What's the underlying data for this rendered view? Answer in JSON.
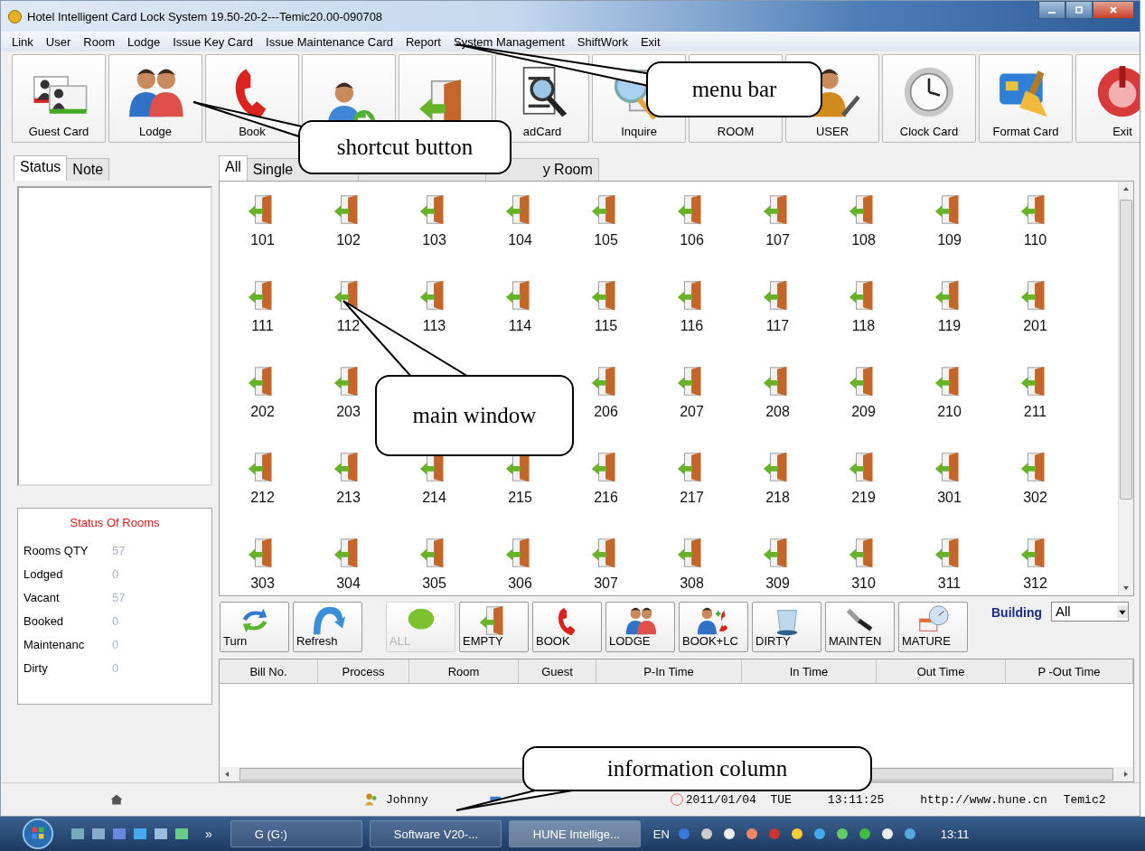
{
  "window": {
    "title": "Hotel Intelligent Card Lock System 19.50-20-2---Temic20.00-090708"
  },
  "menu": [
    "Link",
    "User",
    "Room",
    "Lodge",
    "Issue Key Card",
    "Issue Maintenance Card",
    "Report",
    "System Management",
    "ShiftWork",
    "Exit"
  ],
  "toolbar": [
    {
      "kind": "guest-card",
      "label": "Guest Card"
    },
    {
      "kind": "lodge",
      "label": "Lodge"
    },
    {
      "kind": "book",
      "label": "Book"
    },
    {
      "kind": "checkout"
    },
    {
      "kind": "door"
    },
    {
      "kind": "read-card",
      "label": "adCard"
    },
    {
      "kind": "inquire",
      "label": "Inquire"
    },
    {
      "label": "ROOM"
    },
    {
      "kind": "user",
      "label": "USER"
    },
    {
      "kind": "clock",
      "label": "Clock Card"
    },
    {
      "kind": "format",
      "label": "Format Card"
    },
    {
      "kind": "exit",
      "label": "Exit"
    }
  ],
  "left_tabs": [
    {
      "label": "Status",
      "selected": true
    },
    {
      "label": "Note",
      "selected": false
    }
  ],
  "room_tabs": [
    {
      "label": "All",
      "selected": true
    },
    {
      "label": "Single",
      "selected": false
    },
    {
      "selected": false
    },
    {
      "label": "y Room",
      "selected": false
    }
  ],
  "status_of_rooms": {
    "title": "Status Of Rooms",
    "rows": [
      {
        "label": "Rooms QTY",
        "value": "57"
      },
      {
        "label": "Lodged",
        "value": "0"
      },
      {
        "label": "Vacant",
        "value": "57"
      },
      {
        "label": "Booked",
        "value": "0"
      },
      {
        "label": "Maintenanc",
        "value": "0"
      },
      {
        "label": "Dirty",
        "value": "0"
      }
    ]
  },
  "rooms": [
    {
      "kind": "room",
      "number": "101"
    },
    {
      "kind": "room",
      "number": "102"
    },
    {
      "kind": "room",
      "number": "103"
    },
    {
      "kind": "room",
      "number": "104"
    },
    {
      "kind": "room",
      "number": "105"
    },
    {
      "kind": "room",
      "number": "106"
    },
    {
      "kind": "room",
      "number": "107"
    },
    {
      "kind": "room",
      "number": "108"
    },
    {
      "kind": "room",
      "number": "109"
    },
    {
      "kind": "room",
      "number": "110"
    },
    {
      "kind": "room",
      "number": "111"
    },
    {
      "kind": "room",
      "number": "112"
    },
    {
      "kind": "room",
      "number": "113"
    },
    {
      "kind": "room",
      "number": "114"
    },
    {
      "kind": "room",
      "number": "115"
    },
    {
      "kind": "room",
      "number": "116"
    },
    {
      "kind": "room",
      "number": "117"
    },
    {
      "kind": "room",
      "number": "118"
    },
    {
      "kind": "room",
      "number": "119"
    },
    {
      "kind": "room",
      "number": "201"
    },
    {
      "kind": "room",
      "number": "202"
    },
    {
      "kind": "room",
      "number": "203"
    },
    {
      "kind": "covered"
    },
    {
      "kind": "covered"
    },
    {
      "kind": "room",
      "number": "206"
    },
    {
      "kind": "room",
      "number": "207"
    },
    {
      "kind": "room",
      "number": "208"
    },
    {
      "kind": "room",
      "number": "209"
    },
    {
      "kind": "room",
      "number": "210"
    },
    {
      "kind": "room",
      "number": "211"
    },
    {
      "kind": "room",
      "number": "212"
    },
    {
      "kind": "room",
      "number": "213"
    },
    {
      "kind": "room",
      "number": "214"
    },
    {
      "kind": "room",
      "number": "215"
    },
    {
      "kind": "room",
      "number": "216"
    },
    {
      "kind": "room",
      "number": "217"
    },
    {
      "kind": "room",
      "number": "218"
    },
    {
      "kind": "room",
      "number": "219"
    },
    {
      "kind": "room",
      "number": "301"
    },
    {
      "kind": "room",
      "number": "302"
    },
    {
      "kind": "room",
      "number": "303"
    },
    {
      "kind": "room",
      "number": "304"
    },
    {
      "kind": "room",
      "number": "305"
    },
    {
      "kind": "room",
      "number": "306"
    },
    {
      "kind": "room",
      "number": "307"
    },
    {
      "kind": "room",
      "number": "308"
    },
    {
      "kind": "room",
      "number": "309"
    },
    {
      "kind": "room",
      "number": "310"
    },
    {
      "kind": "room",
      "number": "311"
    },
    {
      "kind": "room",
      "number": "312"
    }
  ],
  "action_buttons": [
    {
      "kind": "turn",
      "label": "Turn",
      "disabled": false
    },
    {
      "kind": "refresh",
      "label": "Refresh",
      "disabled": false
    },
    {
      "kind": "all",
      "label": "ALL",
      "disabled": true
    },
    {
      "kind": "empty",
      "label": "EMPTY",
      "disabled": false
    },
    {
      "kind": "book",
      "label": "BOOK",
      "disabled": false
    },
    {
      "kind": "lodge",
      "label": "LODGE",
      "disabled": false
    },
    {
      "kind": "book-lodge",
      "label": "BOOK+LC",
      "disabled": false
    },
    {
      "kind": "dirty",
      "label": "DIRTY",
      "disabled": false
    },
    {
      "kind": "mainten",
      "label": "MAINTEN",
      "disabled": false
    },
    {
      "kind": "mature",
      "label": "MATURE",
      "disabled": false
    }
  ],
  "building": {
    "label": "Building",
    "value": "All"
  },
  "table": {
    "columns": [
      "Bill No.",
      "Process",
      "Room",
      "Guest",
      "P-In Time",
      "In Time",
      "Out Time",
      "P -Out Time"
    ]
  },
  "status_bar": {
    "user": "Johnny",
    "date": "2011/01/04  TUE",
    "time": "13:11:25",
    "url": "http://www.hune.cn",
    "version": "Temic2"
  },
  "taskbar": {
    "overflow": "»",
    "tasks": [
      {
        "label": "G (G:)",
        "selected": false
      },
      {
        "label": "Software V20-...",
        "selected": false
      },
      {
        "label": "HUNE Intellige...",
        "selected": true
      }
    ],
    "language": "EN",
    "clock": "13:11"
  },
  "annotations": [
    {
      "text": "menu bar"
    },
    {
      "text": "shortcut button"
    },
    {
      "text": "main window"
    },
    {
      "text": "information column"
    }
  ]
}
